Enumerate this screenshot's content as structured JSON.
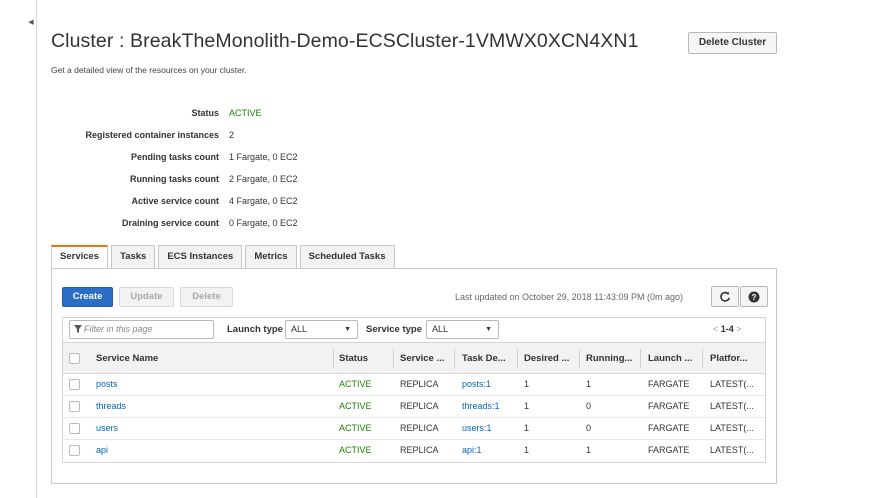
{
  "page": {
    "title": "Cluster : BreakTheMonolith-Demo-ECSCluster-1VMWX0XCN4XN1",
    "subtitle": "Get a detailed view of the resources on your cluster.",
    "delete_cluster_label": "Delete Cluster"
  },
  "details": [
    {
      "label": "Status",
      "value": "ACTIVE"
    },
    {
      "label": "Registered container instances",
      "value": "2"
    },
    {
      "label": "Pending tasks count",
      "value": "1 Fargate, 0 EC2"
    },
    {
      "label": "Running tasks count",
      "value": "2 Fargate, 0 EC2"
    },
    {
      "label": "Active service count",
      "value": "4 Fargate, 0 EC2"
    },
    {
      "label": "Draining service count",
      "value": "0 Fargate, 0 EC2"
    }
  ],
  "tabs": [
    {
      "label": "Services",
      "selected": true
    },
    {
      "label": "Tasks"
    },
    {
      "label": "ECS Instances"
    },
    {
      "label": "Metrics"
    },
    {
      "label": "Scheduled Tasks"
    }
  ],
  "toolbar": {
    "create_label": "Create",
    "update_label": "Update",
    "delete_label": "Delete",
    "last_updated": "Last updated on October 29, 2018 11:43:09 PM (0m ago)"
  },
  "filters": {
    "search_placeholder": "Filter in this page",
    "launch_type_label": "Launch type",
    "launch_type_value": "ALL",
    "service_type_label": "Service type",
    "service_type_value": "ALL",
    "pager_prev": "<",
    "pager_range": "1-4",
    "pager_next": ">"
  },
  "table": {
    "columns": [
      "Service Name",
      "Status",
      "Service ...",
      "Task De...",
      "Desired ...",
      "Running...",
      "Launch ...",
      "Platfor..."
    ],
    "rows": [
      {
        "name": "posts",
        "status": "ACTIVE",
        "service_type": "REPLICA",
        "task_def": "posts:1",
        "desired": "1",
        "running": "1",
        "launch": "FARGATE",
        "platform": "LATEST(..."
      },
      {
        "name": "threads",
        "status": "ACTIVE",
        "service_type": "REPLICA",
        "task_def": "threads:1",
        "desired": "1",
        "running": "0",
        "launch": "FARGATE",
        "platform": "LATEST(..."
      },
      {
        "name": "users",
        "status": "ACTIVE",
        "service_type": "REPLICA",
        "task_def": "users:1",
        "desired": "1",
        "running": "0",
        "launch": "FARGATE",
        "platform": "LATEST(..."
      },
      {
        "name": "api",
        "status": "ACTIVE",
        "service_type": "REPLICA",
        "task_def": "api:1",
        "desired": "1",
        "running": "1",
        "launch": "FARGATE",
        "platform": "LATEST(..."
      }
    ]
  },
  "icons": {
    "refresh": "refresh-icon",
    "help": "help-icon",
    "filter": "filter-icon",
    "collapse": "collapse-arrow-icon"
  },
  "colors": {
    "accent": "#ec7211",
    "primary_button": "#2b6cc4",
    "link": "#0066c0",
    "status_active": "#1d8102"
  }
}
